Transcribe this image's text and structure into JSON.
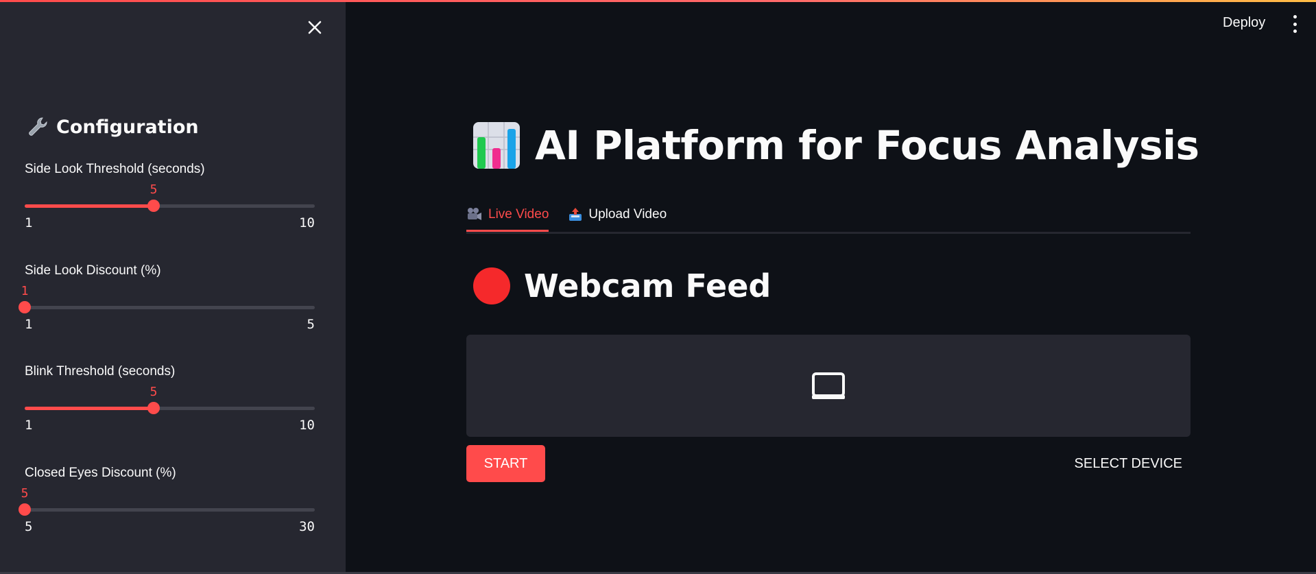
{
  "header": {
    "deploy_label": "Deploy"
  },
  "sidebar": {
    "title": "Configuration",
    "title_icon": "wrench-icon",
    "sliders": [
      {
        "label": "Side Look Threshold (seconds)",
        "value": 5,
        "min": 1,
        "max": 10
      },
      {
        "label": "Side Look Discount (%)",
        "value": 1,
        "min": 1,
        "max": 5
      },
      {
        "label": "Blink Threshold (seconds)",
        "value": 5,
        "min": 1,
        "max": 10
      },
      {
        "label": "Closed Eyes Discount (%)",
        "value": 5,
        "min": 5,
        "max": 30
      }
    ]
  },
  "main": {
    "title": "AI Platform for Focus Analysis",
    "title_icon": "bar-chart-icon",
    "tabs": [
      {
        "label": "Live Video",
        "icon": "movie-camera-icon",
        "active": true
      },
      {
        "label": "Upload Video",
        "icon": "outbox-tray-icon",
        "active": false
      }
    ],
    "section_title": "Webcam Feed",
    "video_icon": "laptop-icon",
    "start_label": "START",
    "select_device_label": "SELECT DEVICE"
  },
  "colors": {
    "accent": "#ff4b4b",
    "background": "#0e1117",
    "sidebar": "#262730"
  }
}
